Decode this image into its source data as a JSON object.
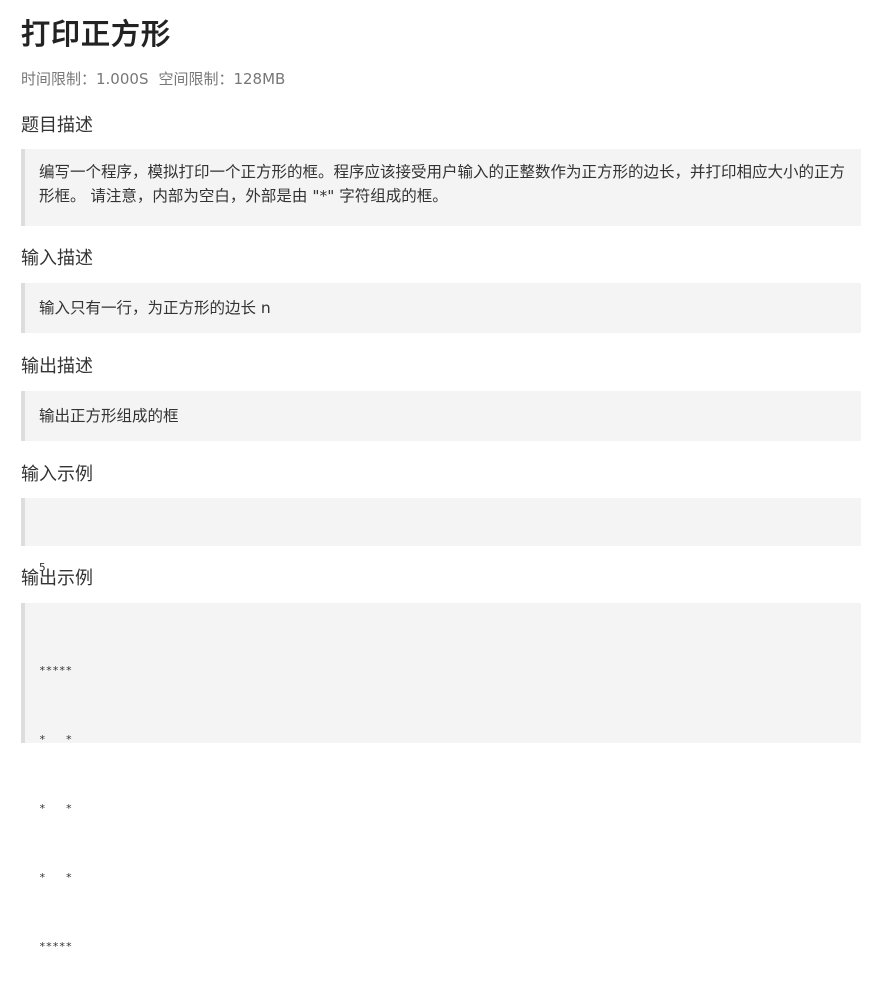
{
  "problem": {
    "title": "打印正方形",
    "time_limit": "时间限制：1.000S",
    "space_limit": "空间限制：128MB"
  },
  "sections": {
    "description": {
      "heading": "题目描述",
      "text": "编写一个程序，模拟打印一个正方形的框。程序应该接受用户输入的正整数作为正方形的边长，并打印相应大小的正方形框。 请注意，内部为空白，外部是由 \"*\" 字符组成的框。"
    },
    "input": {
      "heading": "输入描述",
      "text": "输入只有一行，为正方形的边长 n"
    },
    "output": {
      "heading": "输出描述",
      "text": "输出正方形组成的框"
    },
    "sample_input": {
      "heading": "输入示例",
      "lines": [
        "5"
      ]
    },
    "sample_output": {
      "heading": "输出示例",
      "lines": [
        "*****",
        "*   *",
        "*   *",
        "*   *",
        "*****"
      ]
    }
  }
}
